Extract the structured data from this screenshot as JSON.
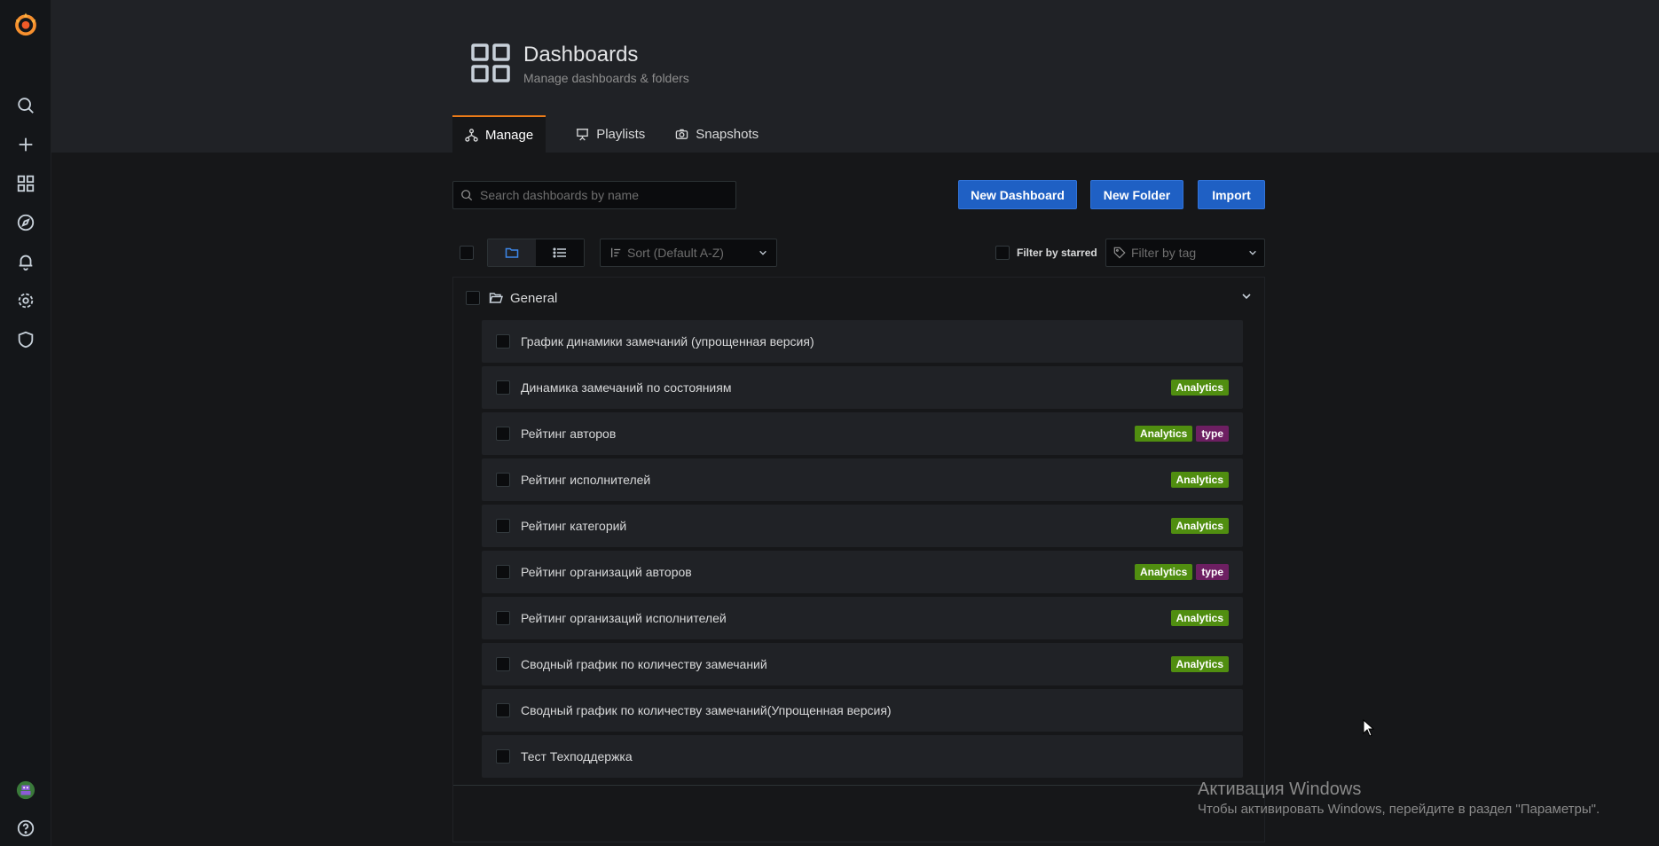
{
  "header": {
    "title": "Dashboards",
    "subtitle": "Manage dashboards & folders"
  },
  "tabs": [
    {
      "label": "Manage",
      "icon": "sitemap-icon",
      "active": true
    },
    {
      "label": "Playlists",
      "icon": "presentation-icon",
      "active": false
    },
    {
      "label": "Snapshots",
      "icon": "camera-icon",
      "active": false
    }
  ],
  "sidebar": {
    "items": [
      "grafana-logo",
      "search-icon",
      "plus-icon",
      "dashboards-icon",
      "explore-icon",
      "alerting-bell-icon",
      "settings-gear-icon",
      "shield-icon",
      "user-avatar",
      "help-icon"
    ]
  },
  "toolbar": {
    "search_placeholder": "Search dashboards by name",
    "new_dashboard": "New Dashboard",
    "new_folder": "New Folder",
    "import": "Import",
    "sort_placeholder": "Sort (Default A-Z)",
    "filter_starred": "Filter by starred",
    "filter_tag_placeholder": "Filter by tag"
  },
  "folder": {
    "name": "General",
    "dashboards": [
      {
        "title": "График динамики замечаний (упрощенная версия)",
        "tags": []
      },
      {
        "title": "Динамика замечаний по состояниям",
        "tags": [
          "Analytics"
        ]
      },
      {
        "title": "Рейтинг авторов",
        "tags": [
          "Analytics",
          "type"
        ]
      },
      {
        "title": "Рейтинг исполнителей",
        "tags": [
          "Analytics"
        ]
      },
      {
        "title": "Рейтинг категорий",
        "tags": [
          "Analytics"
        ]
      },
      {
        "title": "Рейтинг организаций авторов",
        "tags": [
          "Analytics",
          "type"
        ]
      },
      {
        "title": "Рейтинг организаций исполнителей",
        "tags": [
          "Analytics"
        ]
      },
      {
        "title": "Сводный график по количеству замечаний",
        "tags": [
          "Analytics"
        ]
      },
      {
        "title": "Сводный график по количеству замечаний(Упрощенная версия)",
        "tags": []
      },
      {
        "title": "Тест Техподдержка",
        "tags": []
      }
    ]
  },
  "tag_colors": {
    "Analytics": "#508e10",
    "type": "#6d1f62"
  },
  "colors": {
    "accent": "#eb7b18",
    "primary_button": "#1f60c4"
  },
  "watermark": {
    "title": "Активация Windows",
    "subtitle": "Чтобы активировать Windows, перейдите в раздел \"Параметры\"."
  }
}
